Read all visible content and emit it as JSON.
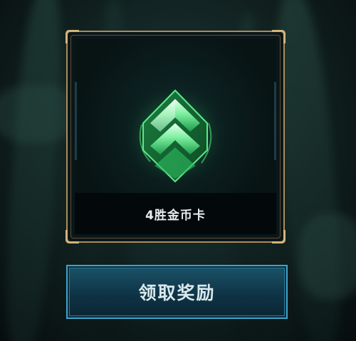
{
  "reward_card": {
    "name": "4胜金币卡",
    "icon": "green-chevron-rank-emblem-icon"
  },
  "claim_button": {
    "label": "领取奖励"
  },
  "colors": {
    "frame_gold": "#a98d5c",
    "button_border": "#3fa3c9",
    "emblem_green": "#3fd86a"
  }
}
